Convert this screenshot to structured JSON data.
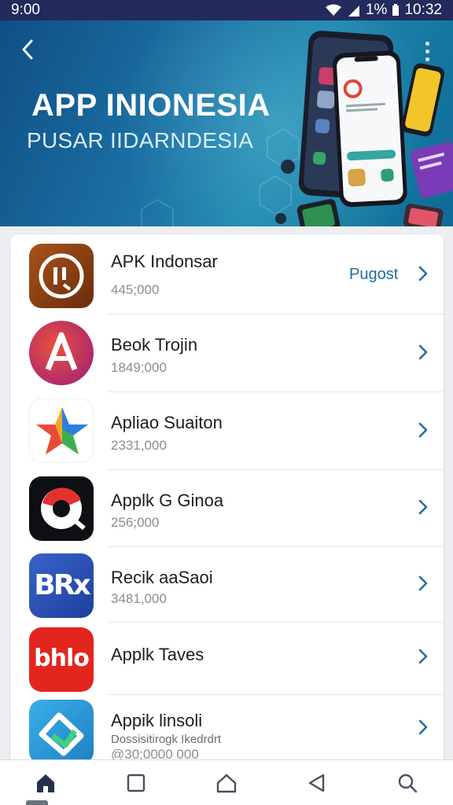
{
  "status_bar": {
    "time": "9:00",
    "battery_text": "1%",
    "clock": "10:32"
  },
  "banner": {
    "title": "APP INIONESIA",
    "subtitle": "PUSAR IIDARNDESIA"
  },
  "apps": [
    {
      "name": "APK Indonsar",
      "count": "445;000",
      "action": "Pugost",
      "icon": "apk-indonsar-app-icon"
    },
    {
      "name": "Beok Trojin",
      "count": "1849;000",
      "icon": "beok-trojin-app-icon"
    },
    {
      "name": "Apliao Suaiton",
      "count": "2331,000",
      "icon": "apliao-suaiton-app-icon"
    },
    {
      "name": "Applk G Ginoa",
      "count": "256;000",
      "icon": "applk-g-ginoa-app-icon"
    },
    {
      "name": "Recik aaSaoi",
      "count": "3481,000",
      "icon": "recik-aasaoi-app-icon"
    },
    {
      "name": "Applk Taves",
      "icon": "applk-taves-app-icon"
    },
    {
      "name": "Appik linsoli",
      "sub": "Dossisitirogk Ikedrdrt",
      "count": "@30;0000 000",
      "icon": "appik-linsoli-app-icon"
    }
  ],
  "icons": {
    "bro_text": "BRx",
    "bhlo_text": "bhlo"
  },
  "colors": {
    "accent": "#1f6fa0",
    "status_bar": "#232a5c",
    "banner": "#1b6fa3"
  }
}
